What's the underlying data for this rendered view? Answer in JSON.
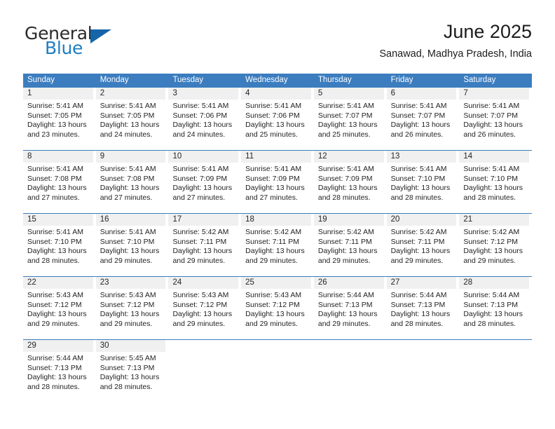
{
  "brand": {
    "name_top": "General",
    "name_bottom": "Blue",
    "triangle_color": "#1565a8",
    "blue_text_color": "#1d7ec4"
  },
  "header": {
    "title": "June 2025",
    "location": "Sanawad, Madhya Pradesh, India"
  },
  "theme": {
    "header_blue": "#3b7dbf",
    "day_band_gray": "#f0f0f0",
    "text_color": "#232323"
  },
  "weekdays": [
    "Sunday",
    "Monday",
    "Tuesday",
    "Wednesday",
    "Thursday",
    "Friday",
    "Saturday"
  ],
  "weeks": [
    [
      {
        "day": "1",
        "sunrise": "Sunrise: 5:41 AM",
        "sunset": "Sunset: 7:05 PM",
        "daylight_line1": "Daylight: 13 hours",
        "daylight_line2": "and 23 minutes."
      },
      {
        "day": "2",
        "sunrise": "Sunrise: 5:41 AM",
        "sunset": "Sunset: 7:05 PM",
        "daylight_line1": "Daylight: 13 hours",
        "daylight_line2": "and 24 minutes."
      },
      {
        "day": "3",
        "sunrise": "Sunrise: 5:41 AM",
        "sunset": "Sunset: 7:06 PM",
        "daylight_line1": "Daylight: 13 hours",
        "daylight_line2": "and 24 minutes."
      },
      {
        "day": "4",
        "sunrise": "Sunrise: 5:41 AM",
        "sunset": "Sunset: 7:06 PM",
        "daylight_line1": "Daylight: 13 hours",
        "daylight_line2": "and 25 minutes."
      },
      {
        "day": "5",
        "sunrise": "Sunrise: 5:41 AM",
        "sunset": "Sunset: 7:07 PM",
        "daylight_line1": "Daylight: 13 hours",
        "daylight_line2": "and 25 minutes."
      },
      {
        "day": "6",
        "sunrise": "Sunrise: 5:41 AM",
        "sunset": "Sunset: 7:07 PM",
        "daylight_line1": "Daylight: 13 hours",
        "daylight_line2": "and 26 minutes."
      },
      {
        "day": "7",
        "sunrise": "Sunrise: 5:41 AM",
        "sunset": "Sunset: 7:07 PM",
        "daylight_line1": "Daylight: 13 hours",
        "daylight_line2": "and 26 minutes."
      }
    ],
    [
      {
        "day": "8",
        "sunrise": "Sunrise: 5:41 AM",
        "sunset": "Sunset: 7:08 PM",
        "daylight_line1": "Daylight: 13 hours",
        "daylight_line2": "and 27 minutes."
      },
      {
        "day": "9",
        "sunrise": "Sunrise: 5:41 AM",
        "sunset": "Sunset: 7:08 PM",
        "daylight_line1": "Daylight: 13 hours",
        "daylight_line2": "and 27 minutes."
      },
      {
        "day": "10",
        "sunrise": "Sunrise: 5:41 AM",
        "sunset": "Sunset: 7:09 PM",
        "daylight_line1": "Daylight: 13 hours",
        "daylight_line2": "and 27 minutes."
      },
      {
        "day": "11",
        "sunrise": "Sunrise: 5:41 AM",
        "sunset": "Sunset: 7:09 PM",
        "daylight_line1": "Daylight: 13 hours",
        "daylight_line2": "and 27 minutes."
      },
      {
        "day": "12",
        "sunrise": "Sunrise: 5:41 AM",
        "sunset": "Sunset: 7:09 PM",
        "daylight_line1": "Daylight: 13 hours",
        "daylight_line2": "and 28 minutes."
      },
      {
        "day": "13",
        "sunrise": "Sunrise: 5:41 AM",
        "sunset": "Sunset: 7:10 PM",
        "daylight_line1": "Daylight: 13 hours",
        "daylight_line2": "and 28 minutes."
      },
      {
        "day": "14",
        "sunrise": "Sunrise: 5:41 AM",
        "sunset": "Sunset: 7:10 PM",
        "daylight_line1": "Daylight: 13 hours",
        "daylight_line2": "and 28 minutes."
      }
    ],
    [
      {
        "day": "15",
        "sunrise": "Sunrise: 5:41 AM",
        "sunset": "Sunset: 7:10 PM",
        "daylight_line1": "Daylight: 13 hours",
        "daylight_line2": "and 28 minutes."
      },
      {
        "day": "16",
        "sunrise": "Sunrise: 5:41 AM",
        "sunset": "Sunset: 7:10 PM",
        "daylight_line1": "Daylight: 13 hours",
        "daylight_line2": "and 29 minutes."
      },
      {
        "day": "17",
        "sunrise": "Sunrise: 5:42 AM",
        "sunset": "Sunset: 7:11 PM",
        "daylight_line1": "Daylight: 13 hours",
        "daylight_line2": "and 29 minutes."
      },
      {
        "day": "18",
        "sunrise": "Sunrise: 5:42 AM",
        "sunset": "Sunset: 7:11 PM",
        "daylight_line1": "Daylight: 13 hours",
        "daylight_line2": "and 29 minutes."
      },
      {
        "day": "19",
        "sunrise": "Sunrise: 5:42 AM",
        "sunset": "Sunset: 7:11 PM",
        "daylight_line1": "Daylight: 13 hours",
        "daylight_line2": "and 29 minutes."
      },
      {
        "day": "20",
        "sunrise": "Sunrise: 5:42 AM",
        "sunset": "Sunset: 7:11 PM",
        "daylight_line1": "Daylight: 13 hours",
        "daylight_line2": "and 29 minutes."
      },
      {
        "day": "21",
        "sunrise": "Sunrise: 5:42 AM",
        "sunset": "Sunset: 7:12 PM",
        "daylight_line1": "Daylight: 13 hours",
        "daylight_line2": "and 29 minutes."
      }
    ],
    [
      {
        "day": "22",
        "sunrise": "Sunrise: 5:43 AM",
        "sunset": "Sunset: 7:12 PM",
        "daylight_line1": "Daylight: 13 hours",
        "daylight_line2": "and 29 minutes."
      },
      {
        "day": "23",
        "sunrise": "Sunrise: 5:43 AM",
        "sunset": "Sunset: 7:12 PM",
        "daylight_line1": "Daylight: 13 hours",
        "daylight_line2": "and 29 minutes."
      },
      {
        "day": "24",
        "sunrise": "Sunrise: 5:43 AM",
        "sunset": "Sunset: 7:12 PM",
        "daylight_line1": "Daylight: 13 hours",
        "daylight_line2": "and 29 minutes."
      },
      {
        "day": "25",
        "sunrise": "Sunrise: 5:43 AM",
        "sunset": "Sunset: 7:12 PM",
        "daylight_line1": "Daylight: 13 hours",
        "daylight_line2": "and 29 minutes."
      },
      {
        "day": "26",
        "sunrise": "Sunrise: 5:44 AM",
        "sunset": "Sunset: 7:13 PM",
        "daylight_line1": "Daylight: 13 hours",
        "daylight_line2": "and 29 minutes."
      },
      {
        "day": "27",
        "sunrise": "Sunrise: 5:44 AM",
        "sunset": "Sunset: 7:13 PM",
        "daylight_line1": "Daylight: 13 hours",
        "daylight_line2": "and 28 minutes."
      },
      {
        "day": "28",
        "sunrise": "Sunrise: 5:44 AM",
        "sunset": "Sunset: 7:13 PM",
        "daylight_line1": "Daylight: 13 hours",
        "daylight_line2": "and 28 minutes."
      }
    ],
    [
      {
        "day": "29",
        "sunrise": "Sunrise: 5:44 AM",
        "sunset": "Sunset: 7:13 PM",
        "daylight_line1": "Daylight: 13 hours",
        "daylight_line2": "and 28 minutes."
      },
      {
        "day": "30",
        "sunrise": "Sunrise: 5:45 AM",
        "sunset": "Sunset: 7:13 PM",
        "daylight_line1": "Daylight: 13 hours",
        "daylight_line2": "and 28 minutes."
      },
      {
        "day": "",
        "sunrise": "",
        "sunset": "",
        "daylight_line1": "",
        "daylight_line2": ""
      },
      {
        "day": "",
        "sunrise": "",
        "sunset": "",
        "daylight_line1": "",
        "daylight_line2": ""
      },
      {
        "day": "",
        "sunrise": "",
        "sunset": "",
        "daylight_line1": "",
        "daylight_line2": ""
      },
      {
        "day": "",
        "sunrise": "",
        "sunset": "",
        "daylight_line1": "",
        "daylight_line2": ""
      },
      {
        "day": "",
        "sunrise": "",
        "sunset": "",
        "daylight_line1": "",
        "daylight_line2": ""
      }
    ]
  ]
}
